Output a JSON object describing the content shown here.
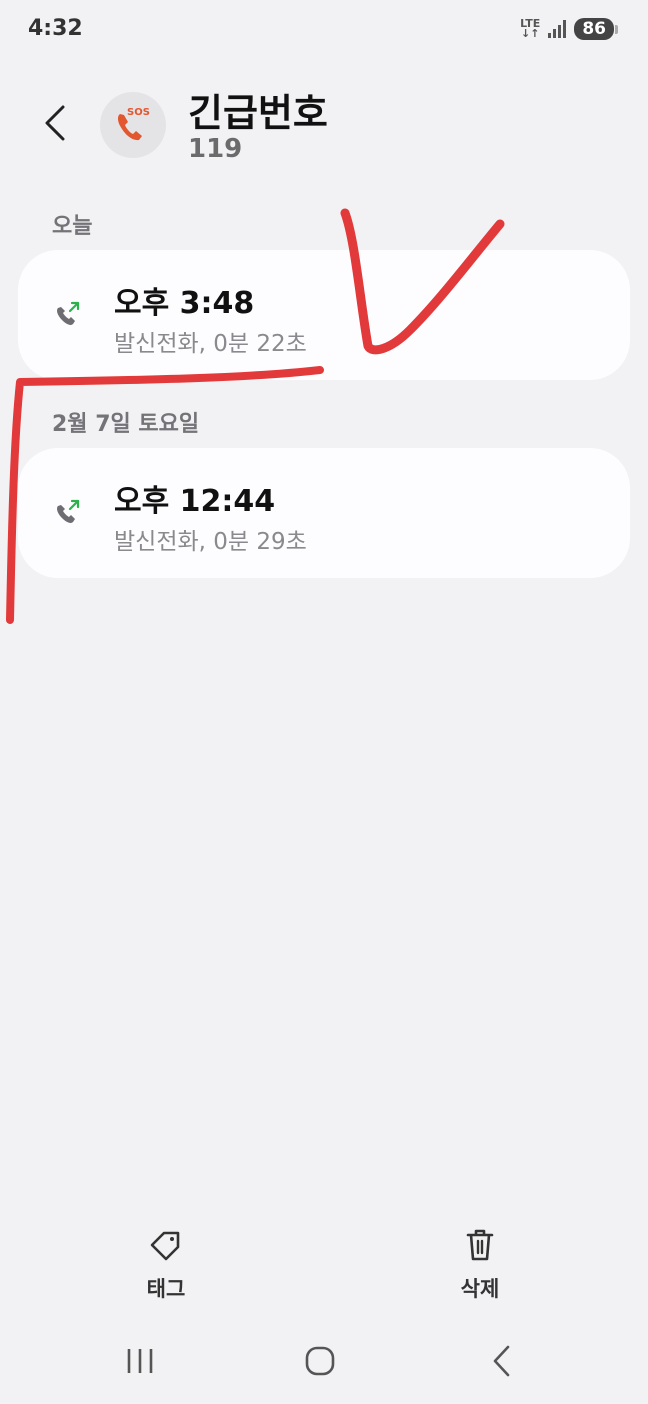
{
  "status_bar": {
    "time": "4:32",
    "network": "LTE",
    "battery": "86"
  },
  "header": {
    "contact_name": "긴급번호",
    "contact_number": "119",
    "avatar_badge": "SOS",
    "avatar_icon": "sos-phone-icon",
    "accent_color": "#e3572f"
  },
  "call_log": [
    {
      "date_label": "오늘",
      "time": "오후 3:48",
      "detail": "발신전화, 0분 22초",
      "type_icon": "outgoing-call-icon"
    },
    {
      "date_label": "2월 7일 토요일",
      "time": "오후 12:44",
      "detail": "발신전화, 0분 29초",
      "type_icon": "outgoing-call-icon"
    }
  ],
  "actions": {
    "tag_label": "태그",
    "delete_label": "삭제"
  },
  "colors": {
    "outgoing_arrow": "#2bb34a",
    "annotation": "#e23a3a"
  }
}
